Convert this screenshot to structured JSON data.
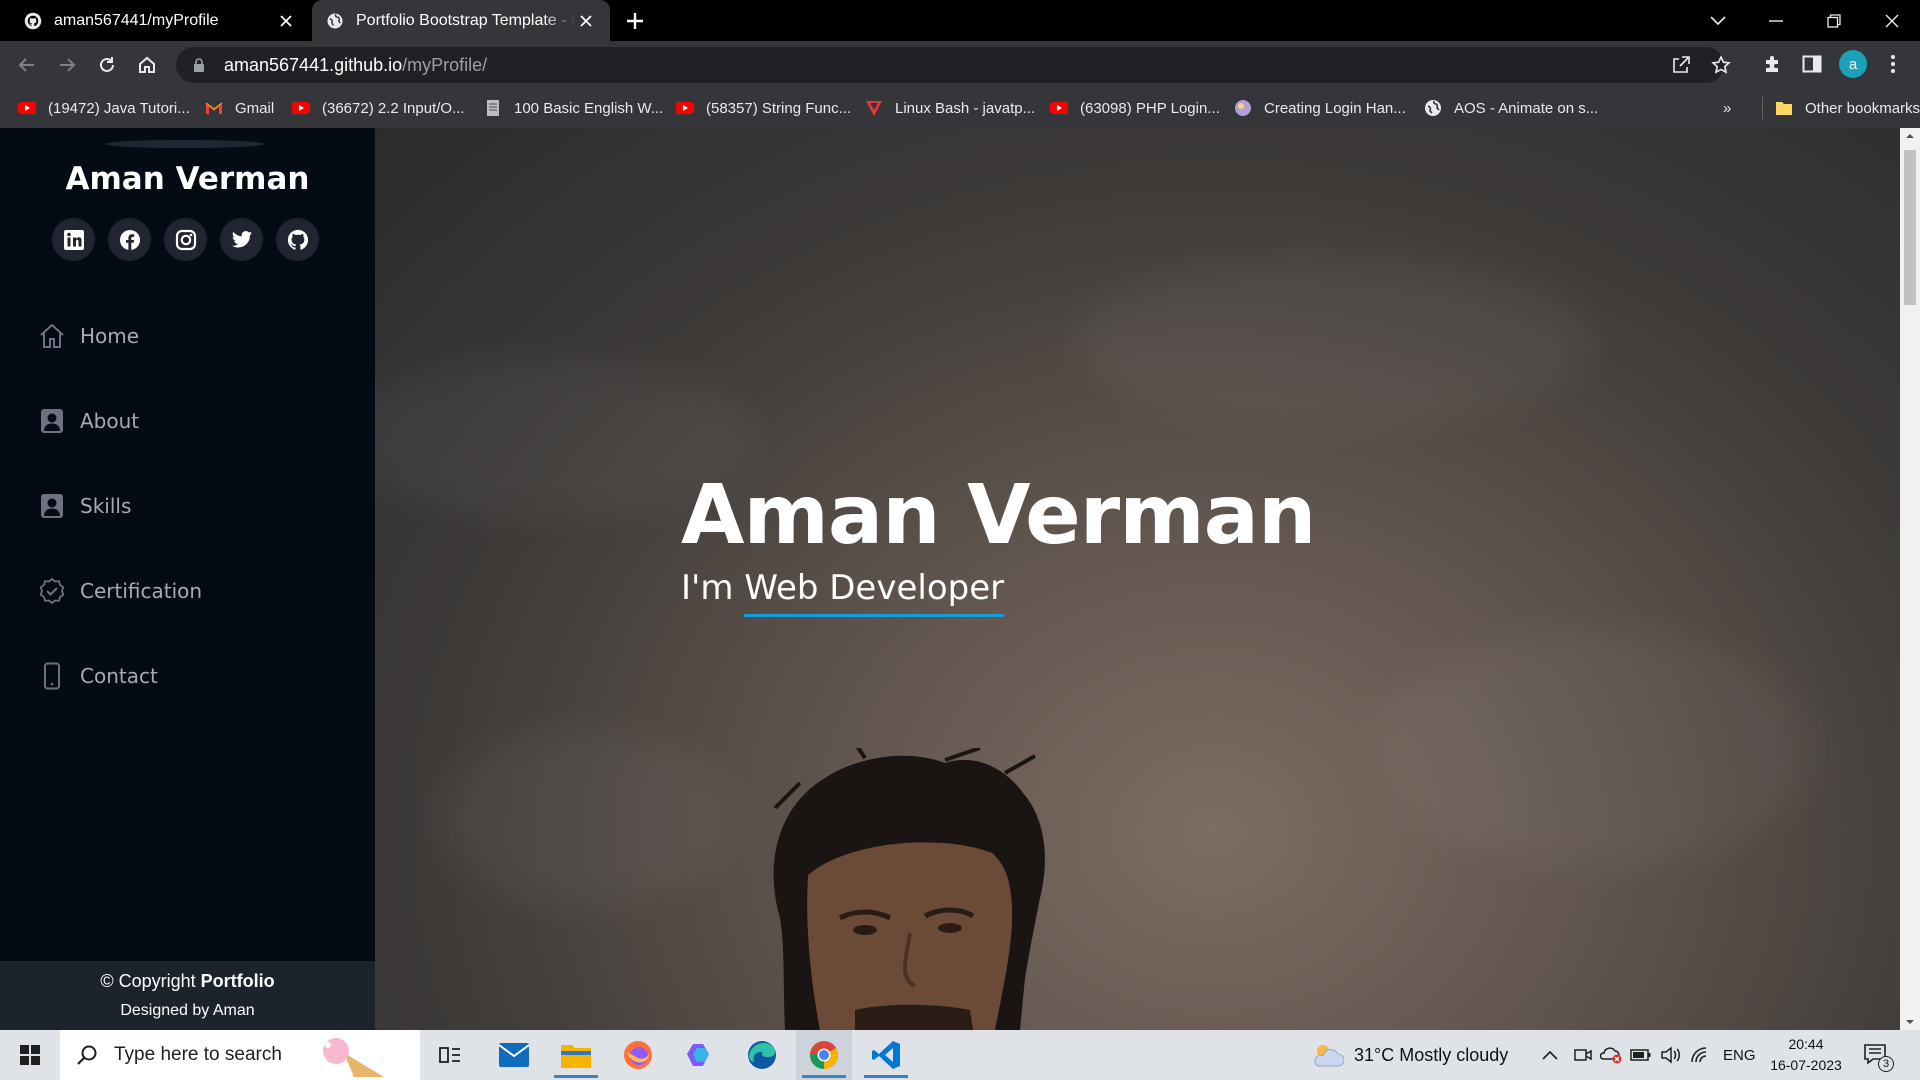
{
  "browser": {
    "tabs": [
      {
        "title": "aman567441/myProfile",
        "icon": "github-icon"
      },
      {
        "title": "Portfolio Bootstrap Template - Index",
        "icon": "globe-icon"
      }
    ],
    "url_host": "aman567441.github.io",
    "url_path": "/myProfile/",
    "profile_initial": "a",
    "bookmarks": [
      {
        "label": "(19472) Java Tutori...",
        "icon": "youtube-icon"
      },
      {
        "label": "Gmail",
        "icon": "gmail-icon"
      },
      {
        "label": "(36672) 2.2 Input/O...",
        "icon": "youtube-icon"
      },
      {
        "label": "100 Basic English W...",
        "icon": "document-icon"
      },
      {
        "label": "(58357) String Func...",
        "icon": "youtube-icon"
      },
      {
        "label": "Linux Bash - javatp...",
        "icon": "javatpoint-icon"
      },
      {
        "label": "(63098) PHP Login...",
        "icon": "youtube-icon"
      },
      {
        "label": "Creating Login Han...",
        "icon": "site-icon"
      },
      {
        "label": "AOS - Animate on s...",
        "icon": "globe-icon"
      }
    ],
    "more_bookmarks": "»",
    "other_bookmarks": "Other bookmarks"
  },
  "sidebar": {
    "name": "Aman Verman",
    "socials": [
      "linkedin-icon",
      "facebook-icon",
      "instagram-icon",
      "twitter-icon",
      "github-icon"
    ],
    "nav": [
      {
        "label": "Home",
        "icon": "home-icon"
      },
      {
        "label": "About",
        "icon": "person-icon"
      },
      {
        "label": "Skills",
        "icon": "person-icon"
      },
      {
        "label": "Certification",
        "icon": "check-badge-icon"
      },
      {
        "label": "Contact",
        "icon": "phone-icon"
      }
    ],
    "footer_prefix": "© Copyright ",
    "footer_brand": "Portfolio",
    "footer_credit": "Designed by Aman"
  },
  "hero": {
    "title": "Aman Verman",
    "subtitle_prefix": "I'm ",
    "subtitle_typed": "Web Developer"
  },
  "taskbar": {
    "search_placeholder": "Type here to search",
    "weather": "31°C  Mostly cloudy",
    "language": "ENG",
    "time": "20:44",
    "date": "16-07-2023",
    "notifications": "3"
  },
  "colors": {
    "sidebar_bg": "#040b14",
    "accent": "#149ddd",
    "social_bg": "#212431"
  }
}
